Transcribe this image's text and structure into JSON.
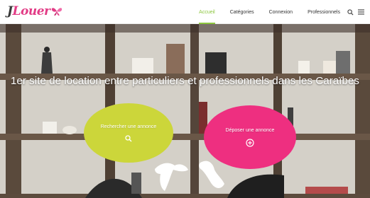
{
  "logo": {
    "text_first": "J",
    "text_rest": "Louer"
  },
  "nav": {
    "items": [
      {
        "label": "Accueil",
        "active": true
      },
      {
        "label": "Catégories",
        "active": false
      },
      {
        "label": "Connexion",
        "active": false
      },
      {
        "label": "Professionnels",
        "active": false
      }
    ],
    "icons": [
      "search-icon",
      "menu-icon"
    ]
  },
  "hero": {
    "title": "1er site de location entre particuliers et professionnels dans les Caraïbes",
    "search_button": {
      "label": "Rechercher une annonce",
      "icon": "search-icon",
      "color": "#ccd63a"
    },
    "post_button": {
      "label": "Déposer une annonce",
      "icon": "plus-circle-icon",
      "color": "#ee2f80"
    }
  },
  "colors": {
    "accent": "#8cc63e",
    "brand": "#e23c86"
  }
}
